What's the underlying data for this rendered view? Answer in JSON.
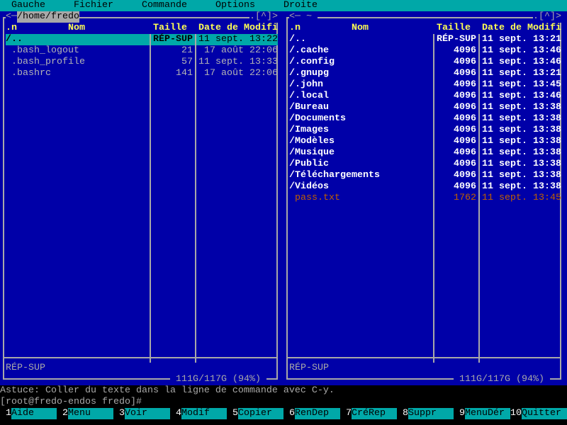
{
  "menubar": {
    "items": [
      "Gauche",
      "Fichier",
      "Commande",
      "Options",
      "Droite"
    ]
  },
  "colors": {
    "panel_bg": "#0000a8",
    "accent": "#00a8a8",
    "header": "#ffff54",
    "special_file": "#c06000"
  },
  "columns": {
    "name_sort": ".n",
    "name": "Nom",
    "size": "Taille",
    "date": "Date de Modifi"
  },
  "left_panel": {
    "path": "/home/fredo",
    "nav_left": "<─",
    "nav_right": ".[^]>",
    "status": "RÉP-SUP",
    "disk": "111G/117G (94%)",
    "rows": [
      {
        "name": "/..",
        "size": "RÉP-SUP",
        "date": "11 sept. 13:22",
        "type": "dir",
        "selected": true
      },
      {
        "name": " .bash_logout",
        "size": "21",
        "date": " 17 août 22:06",
        "type": "file"
      },
      {
        "name": " .bash_profile",
        "size": "57",
        "date": "11 sept. 13:33",
        "type": "file"
      },
      {
        "name": " .bashrc",
        "size": "141",
        "date": " 17 août 22:06",
        "type": "file"
      }
    ]
  },
  "right_panel": {
    "path": " ~ ",
    "nav_left": "<─",
    "nav_right": ".[^]>",
    "status": "RÉP-SUP",
    "disk": "111G/117G (94%)",
    "rows": [
      {
        "name": "/..",
        "size": "RÉP-SUP",
        "date": "11 sept. 13:21",
        "type": "dir"
      },
      {
        "name": "/.cache",
        "size": "4096",
        "date": "11 sept. 13:46",
        "type": "dir"
      },
      {
        "name": "/.config",
        "size": "4096",
        "date": "11 sept. 13:46",
        "type": "dir"
      },
      {
        "name": "/.gnupg",
        "size": "4096",
        "date": "11 sept. 13:21",
        "type": "dir"
      },
      {
        "name": "/.john",
        "size": "4096",
        "date": "11 sept. 13:45",
        "type": "dir"
      },
      {
        "name": "/.local",
        "size": "4096",
        "date": "11 sept. 13:46",
        "type": "dir"
      },
      {
        "name": "/Bureau",
        "size": "4096",
        "date": "11 sept. 13:38",
        "type": "dir"
      },
      {
        "name": "/Documents",
        "size": "4096",
        "date": "11 sept. 13:38",
        "type": "dir"
      },
      {
        "name": "/Images",
        "size": "4096",
        "date": "11 sept. 13:38",
        "type": "dir"
      },
      {
        "name": "/Modèles",
        "size": "4096",
        "date": "11 sept. 13:38",
        "type": "dir"
      },
      {
        "name": "/Musique",
        "size": "4096",
        "date": "11 sept. 13:38",
        "type": "dir"
      },
      {
        "name": "/Public",
        "size": "4096",
        "date": "11 sept. 13:38",
        "type": "dir"
      },
      {
        "name": "/Téléchargements",
        "size": "4096",
        "date": "11 sept. 13:38",
        "type": "dir"
      },
      {
        "name": "/Vidéos",
        "size": "4096",
        "date": "11 sept. 13:38",
        "type": "dir"
      },
      {
        "name": " pass.txt",
        "size": "1762",
        "date": "11 sept. 13:45",
        "type": "special"
      }
    ]
  },
  "hint": "Astuce: Coller du texte dans la ligne de commande avec C-y.",
  "prompt": "[root@fredo-endos fredo]#",
  "keybar": [
    {
      "num": "1",
      "label": "Aide"
    },
    {
      "num": "2",
      "label": "Menu"
    },
    {
      "num": "3",
      "label": "Voir"
    },
    {
      "num": "4",
      "label": "Modif"
    },
    {
      "num": "5",
      "label": "Copier"
    },
    {
      "num": "6",
      "label": "RenDep"
    },
    {
      "num": "7",
      "label": "CréRep"
    },
    {
      "num": "8",
      "label": "Suppr"
    },
    {
      "num": "9",
      "label": "MenuDér"
    },
    {
      "num": "10",
      "label": "Quitter"
    }
  ]
}
